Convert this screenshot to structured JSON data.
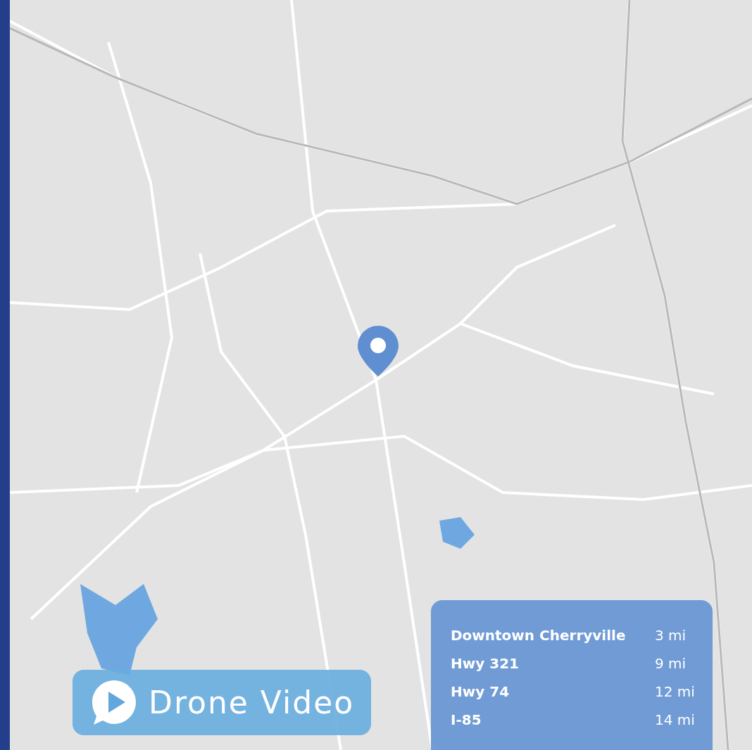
{
  "drone_button": {
    "label": "Drone Video"
  },
  "distances": [
    {
      "place": "Downtown Cherryville",
      "distance": "3 mi"
    },
    {
      "place": "Hwy 321",
      "distance": "9 mi"
    },
    {
      "place": "Hwy 74",
      "distance": "12 mi"
    },
    {
      "place": "I-85",
      "distance": "14 mi"
    }
  ]
}
